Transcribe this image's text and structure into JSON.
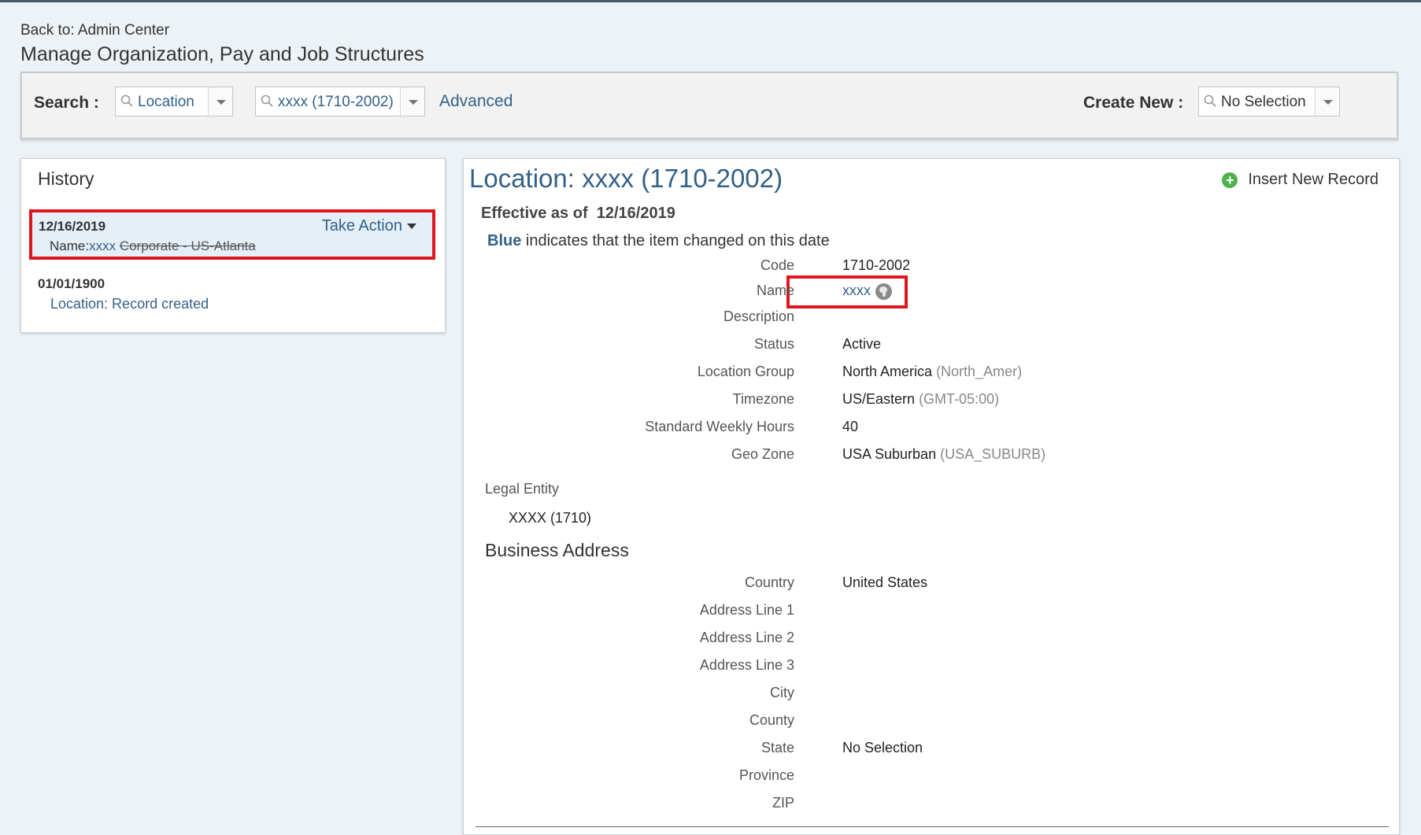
{
  "header": {
    "back_link": "Back to: Admin Center",
    "page_title": "Manage Organization, Pay and Job Structures"
  },
  "search": {
    "label": "Search :",
    "type_value": "Location",
    "record_value": "xxxx (1710-2002)",
    "advanced_link": "Advanced",
    "create_new_label": "Create New :",
    "create_new_value": "No Selection"
  },
  "history": {
    "title": "History",
    "items": [
      {
        "date": "12/16/2019",
        "action_label": "Take Action",
        "detail_prefix": "Name:",
        "detail_new": "xxxx",
        "detail_old": "Corporate - US-Atlanta"
      },
      {
        "date": "01/01/1900",
        "detail": "Location: Record created"
      }
    ]
  },
  "details": {
    "title": "Location: xxxx (1710-2002)",
    "insert_label": "Insert New Record",
    "effective_label": "Effective as of",
    "effective_date": "12/16/2019",
    "legend_blue": "Blue",
    "legend_text": "indicates that the item changed on this date",
    "fields": [
      {
        "label": "Code",
        "value": "1710-2002",
        "sub": ""
      },
      {
        "label": "Name",
        "value": "xxxx",
        "sub": ""
      },
      {
        "label": "Description",
        "value": "",
        "sub": ""
      },
      {
        "label": "Status",
        "value": "Active",
        "sub": ""
      },
      {
        "label": "Location Group",
        "value": "North America",
        "sub": "(North_Amer)"
      },
      {
        "label": "Timezone",
        "value": "US/Eastern",
        "sub": "(GMT-05:00)"
      },
      {
        "label": "Standard Weekly Hours",
        "value": "40",
        "sub": ""
      },
      {
        "label": "Geo Zone",
        "value": "USA Suburban",
        "sub": "(USA_SUBURB)"
      }
    ],
    "legal_entity_label": "Legal Entity",
    "legal_entity_value": "XXXX (1710)",
    "business_address_title": "Business Address",
    "address_fields": [
      {
        "label": "Country",
        "value": "United States"
      },
      {
        "label": "Address Line 1",
        "value": ""
      },
      {
        "label": "Address Line 2",
        "value": ""
      },
      {
        "label": "Address Line 3",
        "value": ""
      },
      {
        "label": "City",
        "value": ""
      },
      {
        "label": "County",
        "value": ""
      },
      {
        "label": "State",
        "value": "No Selection"
      },
      {
        "label": "Province",
        "value": ""
      },
      {
        "label": "ZIP",
        "value": ""
      }
    ]
  }
}
